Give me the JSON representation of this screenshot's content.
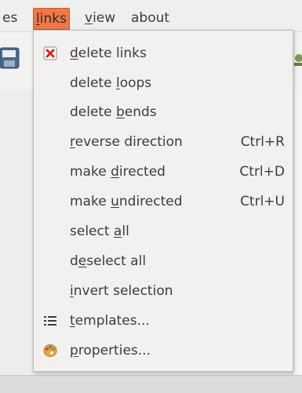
{
  "menubar": {
    "items": [
      {
        "text": "es",
        "mnemonic_index": -1
      },
      {
        "text": "links",
        "mnemonic_index": 0
      },
      {
        "text": "view",
        "mnemonic_index": 0
      },
      {
        "text": "about",
        "mnemonic_index": -1
      }
    ],
    "active_index": 1,
    "active_color": "#f07746"
  },
  "menu": {
    "items": [
      {
        "label": "delete links",
        "mnemonic_index": 0,
        "accel": "",
        "icon": "delete-icon"
      },
      {
        "label": "delete loops",
        "mnemonic_index": 7,
        "accel": "",
        "icon": ""
      },
      {
        "label": "delete bends",
        "mnemonic_index": 7,
        "accel": "",
        "icon": ""
      },
      {
        "label": "reverse direction",
        "mnemonic_index": 0,
        "accel": "Ctrl+R",
        "icon": ""
      },
      {
        "label": "make directed",
        "mnemonic_index": 5,
        "accel": "Ctrl+D",
        "icon": ""
      },
      {
        "label": "make undirected",
        "mnemonic_index": 5,
        "accel": "Ctrl+U",
        "icon": ""
      },
      {
        "label": "select all",
        "mnemonic_index": 7,
        "accel": "",
        "icon": ""
      },
      {
        "label": "deselect all",
        "mnemonic_index": 1,
        "accel": "",
        "icon": ""
      },
      {
        "label": "invert selection",
        "mnemonic_index": 0,
        "accel": "",
        "icon": ""
      },
      {
        "label": "templates...",
        "mnemonic_index": 0,
        "accel": "",
        "icon": "list-icon"
      },
      {
        "label": "properties...",
        "mnemonic_index": 0,
        "accel": "",
        "icon": "palette-icon"
      }
    ]
  }
}
